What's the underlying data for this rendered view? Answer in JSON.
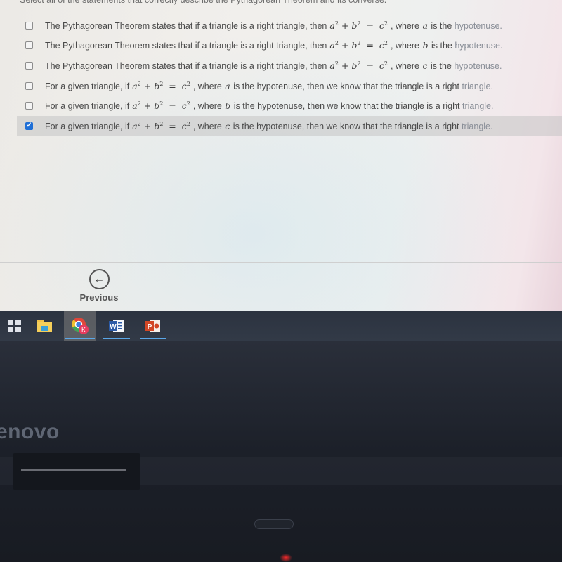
{
  "question": {
    "instruction": "Select all of the statements that correctly describe the Pythagorean Theorem and its converse.",
    "equation": {
      "a": "a",
      "b": "b",
      "c": "c",
      "exp": "2",
      "plus": "+",
      "equals": "="
    },
    "options": [
      {
        "prefix": "The Pythagorean Theorem states that if a triangle is a right triangle, then",
        "middle": ", where",
        "var": "a",
        "suffix": "is the",
        "tail": "hypotenuse.",
        "checked": false
      },
      {
        "prefix": "The Pythagorean Theorem states that if a triangle is a right triangle, then",
        "middle": ", where",
        "var": "b",
        "suffix": "is the",
        "tail": "hypotenuse.",
        "checked": false
      },
      {
        "prefix": "The Pythagorean Theorem states that if a triangle is a right triangle, then",
        "middle": ", where",
        "var": "c",
        "suffix": "is the",
        "tail": "hypotenuse.",
        "checked": false
      },
      {
        "prefix": "For a given triangle, if",
        "middle": ",  where",
        "var": "a",
        "suffix": "is the hypotenuse, then we know that the triangle is a right",
        "tail": "triangle.",
        "checked": false
      },
      {
        "prefix": "For a given triangle, if",
        "middle": ",  where",
        "var": "b",
        "suffix": "is the hypotenuse, then we know that the triangle is a right",
        "tail": "triangle.",
        "checked": false
      },
      {
        "prefix": "For a given triangle, if",
        "middle": ",  where",
        "var": "c",
        "suffix": "is the hypotenuse, then we know that the triangle is a right",
        "tail": "triangle.",
        "checked": true
      }
    ]
  },
  "navigation": {
    "previous_label": "Previous",
    "previous_icon": "arrow-left-circle-icon"
  },
  "taskbar": {
    "items": [
      {
        "name": "windows-start",
        "icon": "windows-logo-icon"
      },
      {
        "name": "file-explorer",
        "icon": "folder-icon"
      },
      {
        "name": "chrome",
        "icon": "chrome-icon",
        "badge": "K",
        "active": true
      },
      {
        "name": "word",
        "icon": "word-icon",
        "label": "W"
      },
      {
        "name": "powerpoint",
        "icon": "powerpoint-icon",
        "label": "P"
      }
    ]
  },
  "device": {
    "brand": "enovo"
  },
  "colors": {
    "checkbox_checked": "#1f6fd6",
    "taskbar": "#2f3643",
    "underline": "#5aa7e8"
  }
}
